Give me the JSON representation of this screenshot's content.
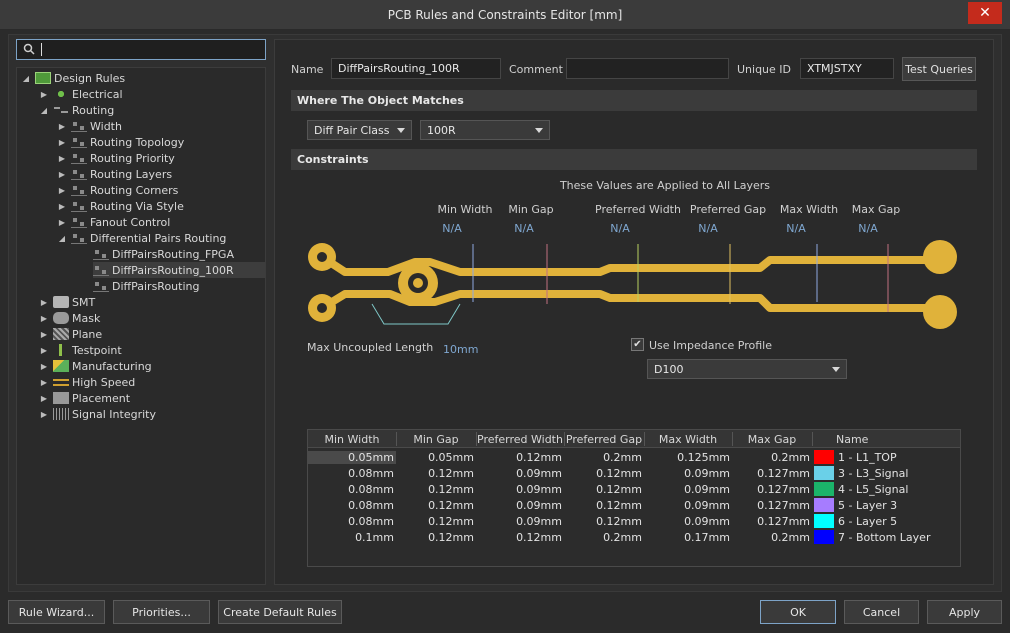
{
  "window": {
    "title": "PCB Rules and Constraints Editor [mm]",
    "close_glyph": "✕"
  },
  "search": {
    "placeholder": ""
  },
  "tree": {
    "root": "Design Rules",
    "items": [
      {
        "label": "Electrical",
        "icon": "electrical-icon"
      },
      {
        "label": "Routing",
        "icon": "routing-icon"
      },
      {
        "label": "Width",
        "icon": "rule-icon"
      },
      {
        "label": "Routing Topology",
        "icon": "rule-icon"
      },
      {
        "label": "Routing Priority",
        "icon": "rule-icon"
      },
      {
        "label": "Routing Layers",
        "icon": "rule-icon"
      },
      {
        "label": "Routing Corners",
        "icon": "rule-icon"
      },
      {
        "label": "Routing Via Style",
        "icon": "rule-icon"
      },
      {
        "label": "Fanout Control",
        "icon": "rule-icon"
      },
      {
        "label": "Differential Pairs Routing",
        "icon": "rule-icon"
      },
      {
        "label": "DiffPairsRouting_FPGA",
        "icon": "rule-icon"
      },
      {
        "label": "DiffPairsRouting_100R",
        "icon": "rule-icon"
      },
      {
        "label": "DiffPairsRouting",
        "icon": "rule-icon"
      },
      {
        "label": "SMT",
        "icon": "smt-icon"
      },
      {
        "label": "Mask",
        "icon": "mask-icon"
      },
      {
        "label": "Plane",
        "icon": "plane-icon"
      },
      {
        "label": "Testpoint",
        "icon": "testpoint-icon"
      },
      {
        "label": "Manufacturing",
        "icon": "manufacturing-icon"
      },
      {
        "label": "High Speed",
        "icon": "high-speed-icon"
      },
      {
        "label": "Placement",
        "icon": "placement-icon"
      },
      {
        "label": "Signal Integrity",
        "icon": "signal-integrity-icon"
      }
    ]
  },
  "rule": {
    "name_label": "Name",
    "name_value": "DiffPairsRouting_100R",
    "comment_label": "Comment",
    "comment_value": "",
    "uid_label": "Unique ID",
    "uid_value": "XTMJSTXY",
    "test_queries": "Test Queries"
  },
  "where": {
    "header": "Where The Object Matches",
    "type": "Diff Pair Class",
    "value": "100R"
  },
  "constraints": {
    "header": "Constraints",
    "applied_note": "These Values are Applied to All Layers",
    "captions": [
      "Min Width",
      "Min Gap",
      "Preferred Width",
      "Preferred Gap",
      "Max Width",
      "Max Gap"
    ],
    "values": [
      "N/A",
      "N/A",
      "N/A",
      "N/A",
      "N/A",
      "N/A"
    ],
    "max_uncoupled_label": "Max Uncoupled Length",
    "max_uncoupled_value": "10mm",
    "use_impedance_label": "Use Impedance Profile",
    "use_impedance_checked": true,
    "impedance_profile": "D100",
    "trace_color": "#e0b23a"
  },
  "table": {
    "headers": [
      "Min Width",
      "Min Gap",
      "Preferred Width",
      "Preferred Gap",
      "Max Width",
      "Max Gap",
      "Name"
    ],
    "rows": [
      {
        "min_width": "0.05mm",
        "min_gap": "0.05mm",
        "pref_width": "0.12mm",
        "pref_gap": "0.2mm",
        "max_width": "0.125mm",
        "max_gap": "0.2mm",
        "color": "#ff0000",
        "name": "1 - L1_TOP"
      },
      {
        "min_width": "0.08mm",
        "min_gap": "0.12mm",
        "pref_width": "0.09mm",
        "pref_gap": "0.12mm",
        "max_width": "0.09mm",
        "max_gap": "0.127mm",
        "color": "#6ad0e8",
        "name": "3 - L3_Signal"
      },
      {
        "min_width": "0.08mm",
        "min_gap": "0.12mm",
        "pref_width": "0.09mm",
        "pref_gap": "0.12mm",
        "max_width": "0.09mm",
        "max_gap": "0.127mm",
        "color": "#1bb46a",
        "name": "4 - L5_Signal"
      },
      {
        "min_width": "0.08mm",
        "min_gap": "0.12mm",
        "pref_width": "0.09mm",
        "pref_gap": "0.12mm",
        "max_width": "0.09mm",
        "max_gap": "0.127mm",
        "color": "#a67cff",
        "name": "5 - Layer 3"
      },
      {
        "min_width": "0.08mm",
        "min_gap": "0.12mm",
        "pref_width": "0.09mm",
        "pref_gap": "0.12mm",
        "max_width": "0.09mm",
        "max_gap": "0.127mm",
        "color": "#00ffff",
        "name": "6 - Layer 5"
      },
      {
        "min_width": "0.1mm",
        "min_gap": "0.12mm",
        "pref_width": "0.12mm",
        "pref_gap": "0.2mm",
        "max_width": "0.17mm",
        "max_gap": "0.2mm",
        "color": "#0000ff",
        "name": "7 - Bottom Layer"
      }
    ]
  },
  "footer": {
    "rule_wizard": "Rule Wizard...",
    "priorities": "Priorities...",
    "create_default": "Create Default Rules",
    "ok": "OK",
    "cancel": "Cancel",
    "apply": "Apply"
  }
}
